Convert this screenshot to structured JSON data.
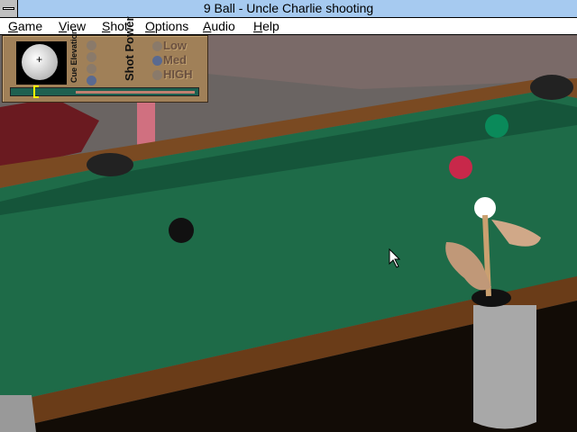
{
  "window": {
    "title": "9 Ball - Uncle Charlie shooting"
  },
  "menu": [
    "Game",
    "View",
    "Shot",
    "Options",
    "Audio",
    "Help"
  ],
  "panel": {
    "cue_elevation_label": "Cue Elevation",
    "shot_power_label": "Shot Power",
    "power_options": [
      "Low",
      "Med",
      "HIGH"
    ],
    "selected_power": "Med",
    "selected_elevation_index": 3
  },
  "balls": [
    {
      "name": "green",
      "color": "#0a8a5a"
    },
    {
      "name": "red",
      "color": "#c8284a"
    },
    {
      "name": "cue",
      "color": "#ffffff"
    },
    {
      "name": "black",
      "color": "#111111"
    }
  ]
}
